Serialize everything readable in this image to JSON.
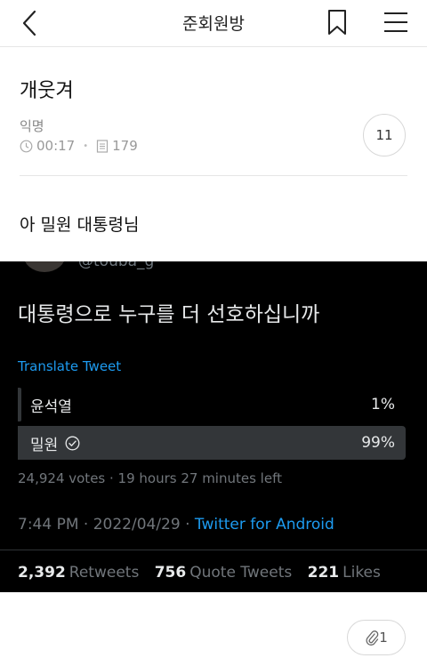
{
  "nav": {
    "title": "준회원방"
  },
  "post": {
    "title": "개웃겨",
    "author": "익명",
    "time": "00:17",
    "views": "179",
    "comment_count": "11",
    "body": "아 밀원 대통령님"
  },
  "tweet": {
    "handle": "@touba_g",
    "text": "대통령으로 누구를 더 선호하십니까",
    "translate": "Translate Tweet",
    "poll": [
      {
        "label": "윤석열",
        "percent": "1%",
        "fraction": 0.01
      },
      {
        "label": "밀원",
        "percent": "99%",
        "fraction": 0.99,
        "selected": true
      }
    ],
    "votes_info": "24,924 votes · 19 hours 27 minutes left",
    "timestamp": "7:44 PM · 2022/04/29 · ",
    "source": "Twitter for Android",
    "retweets_count": "2,392",
    "retweets_label": "Retweets",
    "quotes_count": "756",
    "quotes_label": "Quote Tweets",
    "likes_count": "221",
    "likes_label": "Likes"
  },
  "attachment": {
    "count": "1"
  },
  "colors": {
    "link_blue": "#1d9bf0",
    "tweet_bg": "#000000",
    "poll_bar": "#333639"
  },
  "icons": [
    "back-arrow-icon",
    "bookmark-icon",
    "hamburger-menu-icon",
    "clock-icon",
    "document-icon",
    "check-circle-icon",
    "paperclip-icon"
  ]
}
